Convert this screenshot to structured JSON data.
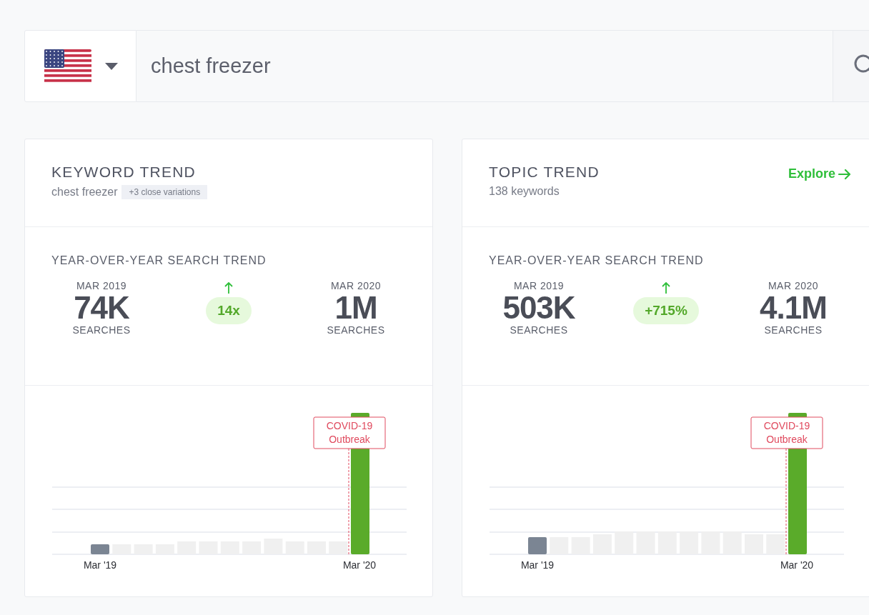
{
  "search": {
    "value": "chest freezer"
  },
  "cards": [
    {
      "kind": "keyword",
      "title": "KEYWORD TREND",
      "subtitle": "chest freezer",
      "tag": "+3 close variations",
      "section_title": "YEAR-OVER-YEAR SEARCH TREND",
      "before": {
        "period": "MAR 2019",
        "value": "74K",
        "unit": "SEARCHES"
      },
      "change": "14x",
      "after": {
        "period": "MAR 2020",
        "value": "1M",
        "unit": "SEARCHES"
      },
      "axis_labels": [
        "Mar '19",
        "Mar '20"
      ],
      "annotation": [
        "COVID-19",
        "Outbreak"
      ]
    },
    {
      "kind": "topic",
      "title": "TOPIC TREND",
      "subtitle": "138 keywords",
      "link": "Explore",
      "section_title": "YEAR-OVER-YEAR SEARCH TREND",
      "before": {
        "period": "MAR 2019",
        "value": "503K",
        "unit": "SEARCHES"
      },
      "change": "+715%",
      "after": {
        "period": "MAR 2020",
        "value": "4.1M",
        "unit": "SEARCHES"
      },
      "axis_labels": [
        "Mar '19",
        "Mar '20"
      ],
      "annotation": [
        "COVID-19",
        "Outbreak"
      ]
    }
  ]
}
